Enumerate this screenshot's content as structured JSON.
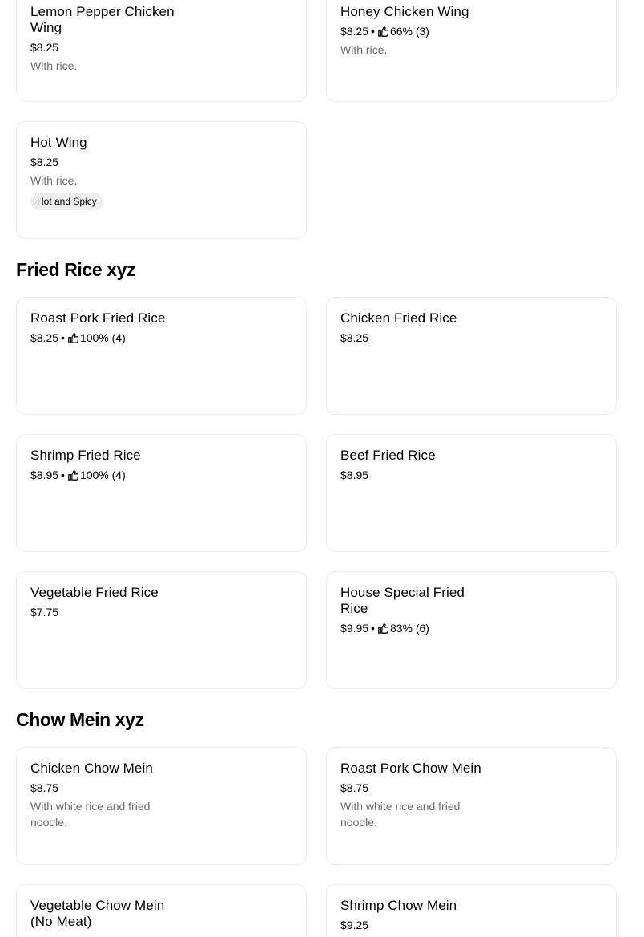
{
  "sections": {
    "wings": {
      "items": [
        {
          "name": "Lemon Pepper Chicken Wing",
          "price": "$8.25",
          "description": "With rice."
        },
        {
          "name": "Honey Chicken Wing",
          "price": "$8.25",
          "rating": "66% (3)",
          "description": "With rice."
        },
        {
          "name": "Hot Wing",
          "price": "$8.25",
          "description": "With rice.",
          "tag": "Hot and Spicy"
        }
      ]
    },
    "fried_rice": {
      "heading": "Fried Rice xyz",
      "items": [
        {
          "name": "Roast Pork Fried Rice",
          "price": "$8.25",
          "rating": "100% (4)"
        },
        {
          "name": "Chicken Fried Rice",
          "price": "$8.25"
        },
        {
          "name": "Shrimp Fried Rice",
          "price": "$8.95",
          "rating": "100% (4)"
        },
        {
          "name": "Beef Fried Rice",
          "price": "$8.95"
        },
        {
          "name": "Vegetable Fried Rice",
          "price": "$7.75"
        },
        {
          "name": "House Special Fried Rice",
          "price": "$9.95",
          "rating": "83% (6)"
        }
      ]
    },
    "chow_mein": {
      "heading": "Chow Mein xyz",
      "items": [
        {
          "name": "Chicken Chow Mein",
          "price": "$8.75",
          "description": "With white rice and fried noodle."
        },
        {
          "name": "Roast Pork Chow Mein",
          "price": "$8.75",
          "description": "With white rice and fried noodle."
        },
        {
          "name": "Vegetable Chow Mein (No Meat)",
          "price": ""
        },
        {
          "name": "Shrimp Chow Mein",
          "price": "$9.25"
        }
      ]
    }
  },
  "icons": {
    "rating": "thumbs-up-icon"
  },
  "separator": "•"
}
